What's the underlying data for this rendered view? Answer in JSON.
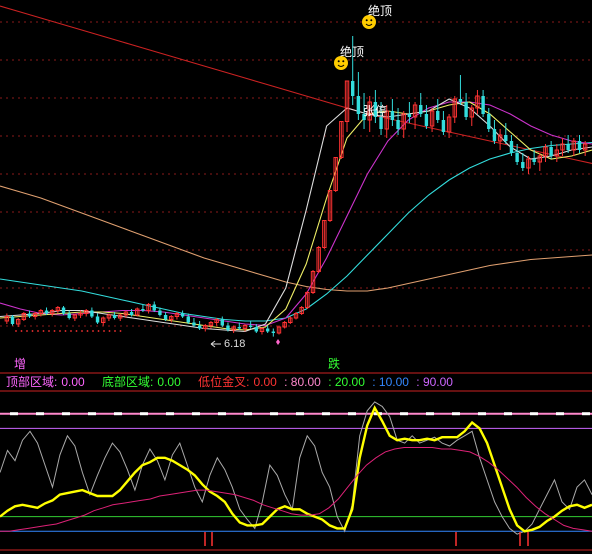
{
  "colors": {
    "background": "#000000",
    "grid": "#8a1a1a",
    "ma_long": "#cc2222",
    "ma_orange": "#e0a070",
    "ma_cyan": "#33dddd",
    "ma_magenta": "#cc33cc",
    "ma_yellow": "#eeee66",
    "ma_white": "#dddddd",
    "candle_up": "#ff3333",
    "candle_down": "#33dddd",
    "limit_up": "#ff2222",
    "osc_gray": "#aaaaaa",
    "osc_yellow": "#ffff00",
    "osc_magenta": "#dd2277",
    "line_pink": "#ff88cc",
    "line_violet": "#cc66ff",
    "line_green": "#33cc33",
    "line_blue": "#3388ff",
    "sep_red": "#cc2222"
  },
  "annotations": {
    "top_signal_1": "绝顶",
    "top_signal_2": "绝顶",
    "limit_up_label": "张停",
    "low_price": "6.18",
    "rise_label": "增",
    "fall_label": "跌"
  },
  "legend": {
    "top_zone_label": "顶部区域:",
    "top_zone_value": "0.00",
    "bottom_zone_label": "底部区域:",
    "bottom_zone_value": "0.00",
    "low_cross_label": "低位金叉:",
    "low_cross_value": "0.00",
    "l80": ": 80.00",
    "l20": ": 20.00",
    "l10": ": 10.00",
    "l90": ": 90.00"
  },
  "chart_data": [
    {
      "type": "candlestick",
      "panel": "price",
      "y_gridlines": 9,
      "candles": [
        [
          6.7,
          6.95,
          6.6,
          6.85
        ],
        [
          6.85,
          6.9,
          6.55,
          6.6
        ],
        [
          6.6,
          6.8,
          6.5,
          6.75
        ],
        [
          6.75,
          7.0,
          6.7,
          6.95
        ],
        [
          6.95,
          7.05,
          6.8,
          6.85
        ],
        [
          6.85,
          7.0,
          6.75,
          6.95
        ],
        [
          6.95,
          7.1,
          6.85,
          7.05
        ],
        [
          7.05,
          7.15,
          6.9,
          6.95
        ],
        [
          6.95,
          7.1,
          6.85,
          7.05
        ],
        [
          7.05,
          7.2,
          6.95,
          7.15
        ],
        [
          7.15,
          7.2,
          6.9,
          6.95
        ],
        [
          6.95,
          7.05,
          6.75,
          6.8
        ],
        [
          6.8,
          6.95,
          6.7,
          6.9
        ],
        [
          6.9,
          7.05,
          6.8,
          6.95
        ],
        [
          6.95,
          7.1,
          6.85,
          7.05
        ],
        [
          7.05,
          7.15,
          6.8,
          6.85
        ],
        [
          6.85,
          6.95,
          6.6,
          6.65
        ],
        [
          6.65,
          6.85,
          6.55,
          6.8
        ],
        [
          6.8,
          6.95,
          6.7,
          6.9
        ],
        [
          6.9,
          7.0,
          6.75,
          6.8
        ],
        [
          6.8,
          6.95,
          6.7,
          6.9
        ],
        [
          6.9,
          7.05,
          6.8,
          7.0
        ],
        [
          7.0,
          7.1,
          6.85,
          6.9
        ],
        [
          6.9,
          7.15,
          6.85,
          7.1
        ],
        [
          7.1,
          7.25,
          7.0,
          7.05
        ],
        [
          7.05,
          7.3,
          6.95,
          7.25
        ],
        [
          7.25,
          7.35,
          7.0,
          7.05
        ],
        [
          7.05,
          7.15,
          6.85,
          6.9
        ],
        [
          6.9,
          7.0,
          6.7,
          6.75
        ],
        [
          6.75,
          6.9,
          6.65,
          6.85
        ],
        [
          6.85,
          7.0,
          6.75,
          6.95
        ],
        [
          6.95,
          7.05,
          6.8,
          6.85
        ],
        [
          6.85,
          6.95,
          6.6,
          6.65
        ],
        [
          6.65,
          6.8,
          6.5,
          6.55
        ],
        [
          6.55,
          6.7,
          6.4,
          6.45
        ],
        [
          6.45,
          6.6,
          6.35,
          6.55
        ],
        [
          6.55,
          6.7,
          6.45,
          6.65
        ],
        [
          6.65,
          6.8,
          6.55,
          6.75
        ],
        [
          6.75,
          6.85,
          6.5,
          6.55
        ],
        [
          6.55,
          6.65,
          6.35,
          6.4
        ],
        [
          6.4,
          6.55,
          6.3,
          6.5
        ],
        [
          6.5,
          6.65,
          6.4,
          6.45
        ],
        [
          6.45,
          6.6,
          6.35,
          6.55
        ],
        [
          6.55,
          6.7,
          6.45,
          6.5
        ],
        [
          6.5,
          6.6,
          6.3,
          6.35
        ],
        [
          6.35,
          6.5,
          6.25,
          6.45
        ],
        [
          6.45,
          6.55,
          6.3,
          6.35
        ],
        [
          6.35,
          6.45,
          6.18,
          6.3
        ],
        [
          6.3,
          6.55,
          6.25,
          6.5
        ],
        [
          6.5,
          6.7,
          6.45,
          6.65
        ],
        [
          6.65,
          6.85,
          6.6,
          6.8
        ],
        [
          6.8,
          7.0,
          6.75,
          6.95
        ],
        [
          6.95,
          7.2,
          6.9,
          7.15
        ],
        [
          7.15,
          7.7,
          7.1,
          7.65
        ],
        [
          7.65,
          8.4,
          7.6,
          8.35
        ],
        [
          8.35,
          9.2,
          8.3,
          9.15
        ],
        [
          9.15,
          10.05,
          9.1,
          10.05
        ],
        [
          10.05,
          11.05,
          10.0,
          11.05
        ],
        [
          11.05,
          12.15,
          11.0,
          12.15
        ],
        [
          12.15,
          13.35,
          12.1,
          13.35
        ],
        [
          13.35,
          14.7,
          13.0,
          14.7
        ],
        [
          14.7,
          16.2,
          13.9,
          14.2
        ],
        [
          14.2,
          15.0,
          13.4,
          13.6
        ],
        [
          13.6,
          14.3,
          13.1,
          13.4
        ],
        [
          13.4,
          14.2,
          13.0,
          14.0
        ],
        [
          14.0,
          14.4,
          13.3,
          13.5
        ],
        [
          13.5,
          14.0,
          12.9,
          13.1
        ],
        [
          13.1,
          13.9,
          12.8,
          13.7
        ],
        [
          13.7,
          14.1,
          13.2,
          13.4
        ],
        [
          13.4,
          13.8,
          12.9,
          13.1
        ],
        [
          13.1,
          13.7,
          12.8,
          13.6
        ],
        [
          13.6,
          14.0,
          13.3,
          13.5
        ],
        [
          13.5,
          14.0,
          13.1,
          13.9
        ],
        [
          13.9,
          14.3,
          13.5,
          13.6
        ],
        [
          13.6,
          13.9,
          13.1,
          13.2
        ],
        [
          13.2,
          13.8,
          13.0,
          13.7
        ],
        [
          13.7,
          14.1,
          13.3,
          13.4
        ],
        [
          13.4,
          13.7,
          12.9,
          13.0
        ],
        [
          13.0,
          13.6,
          12.8,
          13.5
        ],
        [
          13.5,
          14.2,
          13.3,
          14.1
        ],
        [
          14.1,
          14.9,
          13.9,
          14.0
        ],
        [
          14.0,
          14.3,
          13.4,
          13.5
        ],
        [
          13.5,
          13.9,
          13.2,
          13.8
        ],
        [
          13.8,
          14.4,
          13.6,
          14.2
        ],
        [
          14.2,
          14.4,
          13.5,
          13.6
        ],
        [
          13.6,
          13.8,
          13.0,
          13.1
        ],
        [
          13.1,
          13.4,
          12.6,
          12.7
        ],
        [
          12.7,
          13.1,
          12.4,
          12.9
        ],
        [
          12.9,
          13.3,
          12.6,
          12.7
        ],
        [
          12.7,
          12.9,
          12.2,
          12.3
        ],
        [
          12.3,
          12.6,
          11.9,
          12.0
        ],
        [
          12.0,
          12.3,
          11.7,
          11.8
        ],
        [
          11.8,
          12.2,
          11.6,
          12.1
        ],
        [
          12.1,
          12.4,
          11.9,
          12.0
        ],
        [
          12.0,
          12.3,
          11.7,
          12.2
        ],
        [
          12.2,
          12.6,
          12.0,
          12.5
        ],
        [
          12.5,
          12.7,
          12.1,
          12.2
        ],
        [
          12.2,
          12.6,
          12.0,
          12.4
        ],
        [
          12.4,
          12.8,
          12.2,
          12.6
        ],
        [
          12.6,
          12.9,
          12.3,
          12.4
        ],
        [
          12.4,
          12.8,
          12.2,
          12.7
        ],
        [
          12.7,
          12.9,
          12.3,
          12.4
        ],
        [
          12.4,
          12.7,
          12.2,
          12.6
        ]
      ],
      "moving_averages": [
        {
          "color_key": "ma_long",
          "values": [
            17.2,
            17.0,
            16.8,
            16.6,
            16.4,
            16.2,
            16.0,
            15.8,
            15.6,
            15.4,
            15.2,
            15.0,
            14.8,
            14.6,
            14.4,
            14.2,
            14.0,
            13.8,
            13.6,
            13.45,
            13.3,
            13.15,
            13.0,
            12.85,
            12.7,
            12.55,
            12.4,
            12.25,
            12.1,
            11.95
          ]
        },
        {
          "color_key": "ma_orange",
          "values": [
            11.2,
            11.0,
            10.8,
            10.55,
            10.3,
            10.05,
            9.8,
            9.55,
            9.3,
            9.05,
            8.8,
            8.6,
            8.4,
            8.2,
            8.0,
            7.85,
            7.75,
            7.7,
            7.7,
            7.8,
            7.95,
            8.1,
            8.25,
            8.4,
            8.55,
            8.65,
            8.75,
            8.8,
            8.85,
            8.9
          ]
        },
        {
          "color_key": "ma_cyan",
          "values": [
            8.1,
            8.0,
            7.9,
            7.8,
            7.7,
            7.55,
            7.4,
            7.25,
            7.1,
            6.95,
            6.85,
            6.75,
            6.7,
            6.7,
            6.8,
            7.1,
            7.6,
            8.2,
            8.9,
            9.6,
            10.3,
            10.9,
            11.4,
            11.8,
            12.1,
            12.3,
            12.45,
            12.55,
            12.6,
            12.65
          ]
        },
        {
          "color_key": "ma_magenta",
          "values": [
            7.3,
            7.1,
            6.95,
            6.9,
            6.95,
            7.0,
            7.05,
            7.05,
            7.0,
            6.9,
            6.8,
            6.7,
            6.6,
            6.55,
            6.8,
            7.6,
            8.8,
            10.2,
            11.6,
            12.7,
            13.4,
            13.8,
            14.0,
            14.0,
            13.9,
            13.6,
            13.2,
            12.9,
            12.7,
            12.6
          ]
        },
        {
          "color_key": "ma_yellow",
          "values": [
            6.8,
            6.85,
            6.9,
            6.95,
            7.0,
            7.0,
            6.95,
            6.85,
            6.75,
            6.65,
            6.55,
            6.45,
            6.4,
            6.5,
            7.1,
            8.6,
            10.8,
            12.8,
            13.6,
            13.7,
            13.6,
            13.7,
            13.9,
            14.0,
            13.6,
            13.0,
            12.4,
            12.1,
            12.2,
            12.4
          ]
        },
        {
          "color_key": "ma_white",
          "values": [
            6.85,
            6.9,
            6.95,
            7.05,
            7.05,
            6.95,
            6.85,
            6.75,
            6.65,
            6.55,
            6.45,
            6.4,
            6.35,
            6.6,
            7.8,
            10.4,
            13.2,
            13.8,
            13.6,
            13.5,
            13.6,
            13.7,
            14.1,
            13.8,
            13.2,
            12.5,
            12.1,
            12.2,
            12.4,
            12.5
          ]
        }
      ]
    },
    {
      "type": "line",
      "panel": "oscillator",
      "ylim": [
        0,
        100
      ],
      "reference_lines": [
        90,
        80,
        20,
        10
      ],
      "series": [
        {
          "color_key": "osc_gray",
          "values": [
            50,
            65,
            58,
            72,
            78,
            70,
            55,
            40,
            62,
            75,
            68,
            50,
            35,
            48,
            60,
            70,
            64,
            52,
            38,
            55,
            66,
            58,
            45,
            62,
            70,
            55,
            40,
            30,
            48,
            60,
            52,
            40,
            25,
            18,
            12,
            30,
            55,
            48,
            35,
            25,
            60,
            75,
            68,
            50,
            40,
            20,
            10,
            28,
            75,
            92,
            98,
            95,
            88,
            72,
            70,
            75,
            70,
            72,
            74,
            70,
            68,
            72,
            75,
            78,
            60,
            45,
            30,
            20,
            12,
            8,
            10,
            15,
            25,
            35,
            45,
            30,
            25,
            40,
            45,
            35
          ]
        },
        {
          "color_key": "osc_yellow",
          "values": [
            20,
            24,
            27,
            28,
            27,
            26,
            29,
            31,
            35,
            36,
            37,
            38,
            36,
            34,
            34,
            34,
            38,
            44,
            50,
            55,
            57,
            60,
            60,
            58,
            55,
            52,
            48,
            42,
            37,
            34,
            30,
            22,
            16,
            14,
            14,
            15,
            20,
            25,
            27,
            25,
            25,
            22,
            20,
            18,
            14,
            12,
            12,
            25,
            60,
            82,
            94,
            85,
            75,
            72,
            73,
            72,
            72,
            73,
            72,
            74,
            74,
            74,
            78,
            84,
            80,
            70,
            55,
            40,
            25,
            14,
            10,
            11,
            13,
            17,
            20,
            24,
            27,
            28,
            26,
            28
          ]
        },
        {
          "color_key": "osc_magenta",
          "values": [
            10,
            10,
            11,
            12,
            13,
            14,
            15,
            17,
            19,
            21,
            24,
            26,
            28,
            29,
            30,
            31,
            32,
            34,
            35,
            36,
            37,
            38,
            38,
            37,
            36,
            35,
            33,
            31,
            28,
            26,
            24,
            22,
            21,
            21,
            22,
            26,
            32,
            40,
            48,
            55,
            60,
            64,
            66,
            67,
            67,
            67,
            67,
            66,
            66,
            65,
            64,
            61,
            57,
            52,
            46,
            40,
            33,
            27,
            22,
            18,
            14,
            12,
            11,
            10
          ]
        }
      ]
    }
  ]
}
